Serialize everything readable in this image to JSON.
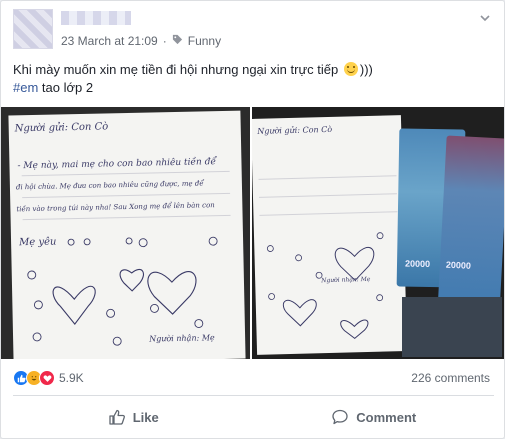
{
  "post": {
    "timestamp": "23 March at 21:09",
    "privacy_sep": "·",
    "category": "Funny",
    "text_line1_a": "Khi mày muốn xin mẹ tiền đi hội nhưng ngại xin trực tiếp",
    "text_line1_b": ")))",
    "hashtag": "#em",
    "text_line2": " tao lớp 2"
  },
  "photo_left": {
    "lines": [
      "Người gửi: Con Cò",
      "- Mẹ này, mai mẹ cho con bao nhiêu tiền để",
      "đi hội chùa. Mẹ đưa con bao nhiêu cũng được, mẹ để",
      "tiền vào trong túi này nha! Sau Xong mẹ để lên bàn con",
      "Mẹ yêu",
      "Người nhận: Mẹ"
    ]
  },
  "photo_right": {
    "lines": [
      "Người gửi: Con Cò",
      "Người nhận: Mẹ"
    ],
    "notes": [
      "20000",
      "20000"
    ]
  },
  "reactions": {
    "count": "5.9K",
    "comments": "226 comments",
    "colors": {
      "like": "#1877f2",
      "haha": "#f7b125",
      "love": "#f0284a"
    }
  },
  "actions": {
    "like": "Like",
    "comment": "Comment"
  }
}
